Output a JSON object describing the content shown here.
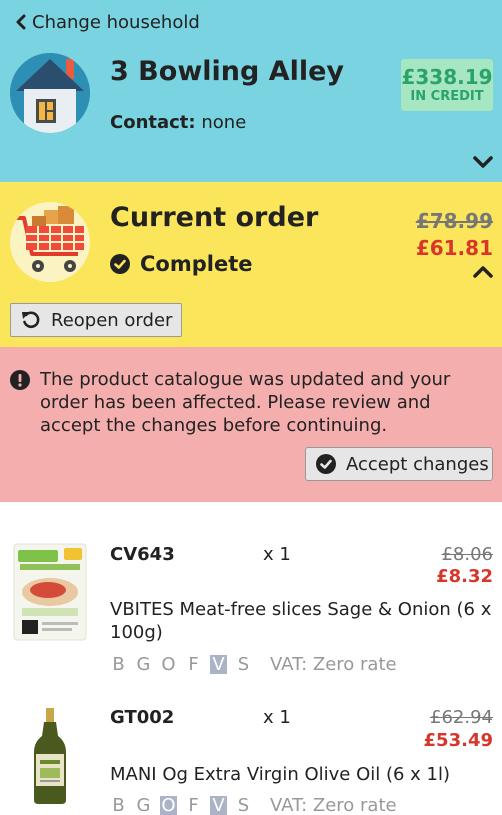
{
  "household": {
    "back_label": "Change household",
    "name": "3 Bowling Alley",
    "contact_label": "Contact:",
    "contact_value": "none",
    "credit_amount": "£338.19",
    "credit_label": "IN CREDIT",
    "avatar_icon": "house-icon",
    "bg_color": "#7ad3e0"
  },
  "order": {
    "title": "Current order",
    "status": "Complete",
    "old_total": "£78.99",
    "new_total": "£61.81",
    "reopen_label": "Reopen order",
    "icon": "shopping-cart-icon",
    "bg_color": "#fbe55a"
  },
  "alert": {
    "message": "The product catalogue was updated and your order has been affected. Please review and accept the changes before continuing.",
    "accept_label": "Accept changes",
    "bg_color": "#f4aeae"
  },
  "items": [
    {
      "code": "CV643",
      "qty": "x 1",
      "old_price": "£8.06",
      "new_price": "£8.32",
      "description": "VBITES Meat-free slices Sage & Onion (6 x 100g)",
      "tags": [
        "B",
        "G",
        "O",
        "F",
        "V",
        "S"
      ],
      "active_tags": [
        "V"
      ],
      "vat": "VAT: Zero rate"
    },
    {
      "code": "GT002",
      "qty": "x 1",
      "old_price": "£62.94",
      "new_price": "£53.49",
      "description": "MANI Og Extra Virgin Olive Oil (6 x 1l)",
      "tags": [
        "B",
        "G",
        "O",
        "F",
        "V",
        "S"
      ],
      "active_tags": [
        "O",
        "V"
      ],
      "vat": "VAT: Zero rate"
    }
  ]
}
